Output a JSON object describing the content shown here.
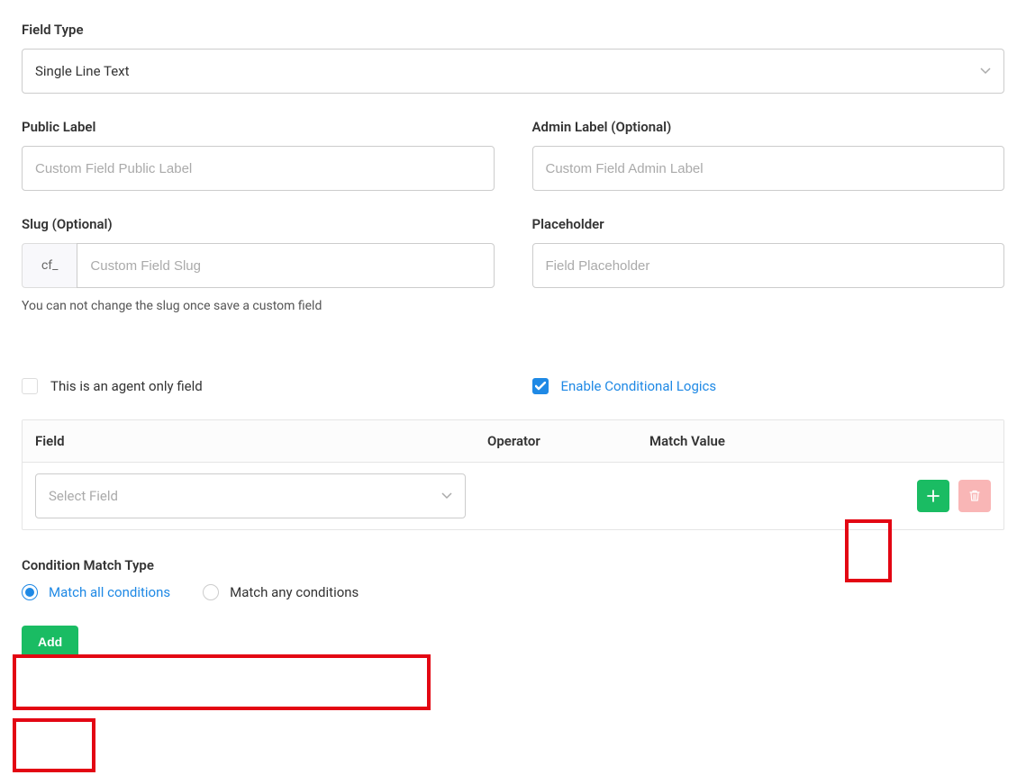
{
  "fieldType": {
    "label": "Field Type",
    "value": "Single Line Text"
  },
  "publicLabel": {
    "label": "Public Label",
    "placeholder": "Custom Field Public Label",
    "value": ""
  },
  "adminLabel": {
    "label": "Admin Label (Optional)",
    "placeholder": "Custom Field Admin Label",
    "value": ""
  },
  "slug": {
    "label": "Slug (Optional)",
    "prefix": "cf_",
    "placeholder": "Custom Field Slug",
    "value": "",
    "help": "You can not change the slug once save a custom field"
  },
  "placeholder": {
    "label": "Placeholder",
    "placeholder": "Field Placeholder",
    "value": ""
  },
  "agentOnly": {
    "label": "This is an agent only field",
    "checked": false
  },
  "conditionalLogics": {
    "label": "Enable Conditional Logics",
    "checked": true
  },
  "conditions": {
    "headers": {
      "field": "Field",
      "operator": "Operator",
      "matchValue": "Match Value"
    },
    "rows": [
      {
        "fieldPlaceholder": "Select Field",
        "operator": "",
        "matchValue": ""
      }
    ]
  },
  "matchType": {
    "label": "Condition Match Type",
    "options": [
      {
        "label": "Match all conditions",
        "selected": true
      },
      {
        "label": "Match any conditions",
        "selected": false
      }
    ]
  },
  "addButton": "Add"
}
